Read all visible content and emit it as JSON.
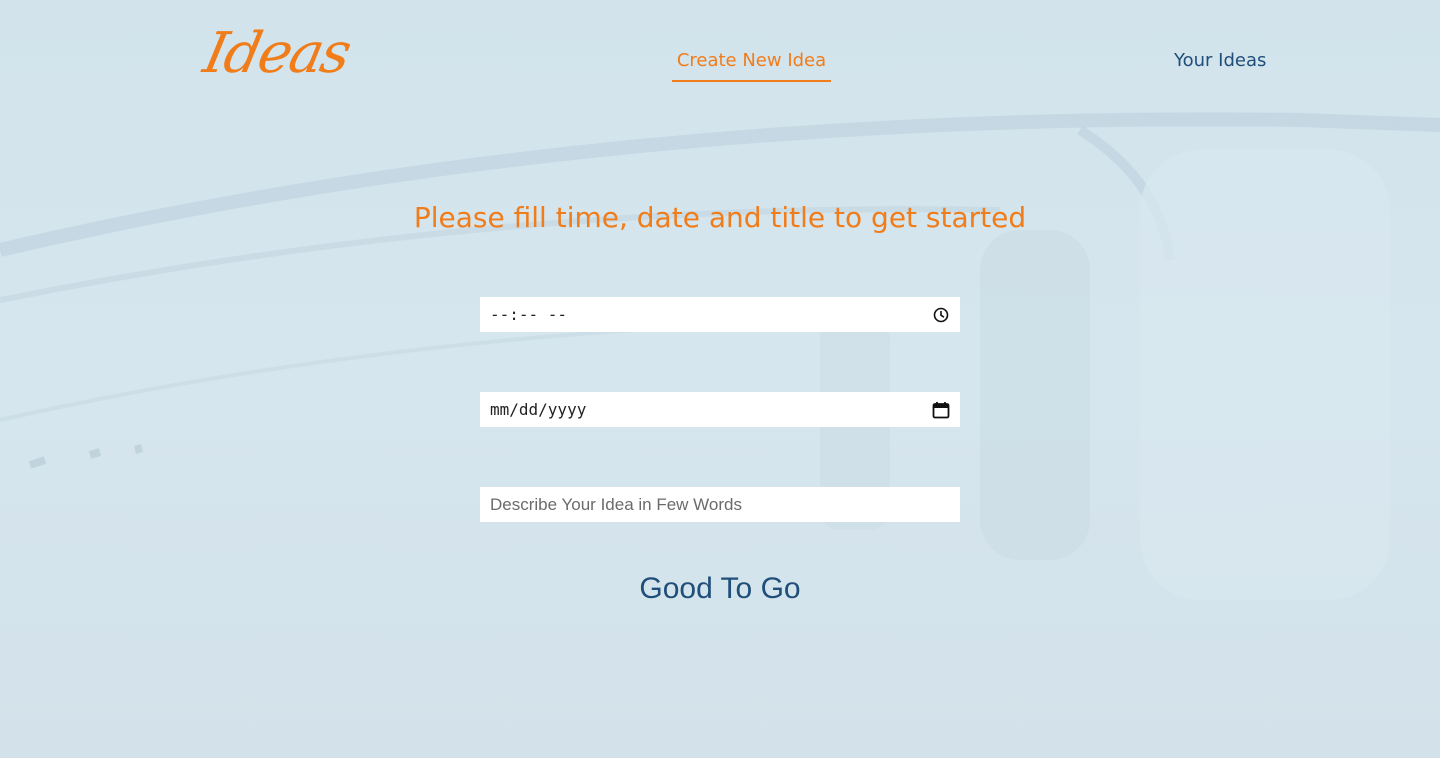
{
  "header": {
    "logo_text": "Ideas",
    "nav": {
      "create_label": "Create New Idea",
      "your_ideas_label": "Your Ideas"
    }
  },
  "form": {
    "heading": "Please fill time, date and title to get started",
    "time_value": "--:-- --",
    "date_value": "mm/dd/yyyy",
    "title_placeholder": "Describe Your Idea in Few Words",
    "submit_label": "Good To Go"
  },
  "icons": {
    "time": "clock-icon",
    "date": "calendar-icon"
  },
  "colors": {
    "accent": "#f07c1a",
    "primary_text": "#1f4e79",
    "background": "#cfe1ea"
  }
}
